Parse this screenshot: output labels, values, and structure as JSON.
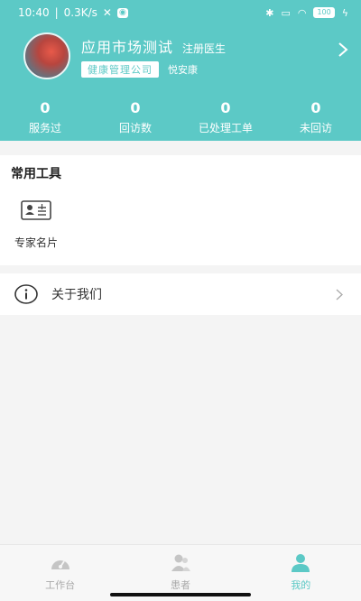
{
  "status": {
    "time": "10:40",
    "speed": "0.3K/s",
    "battery": "100"
  },
  "profile": {
    "name": "应用市场测试",
    "role": "注册医生",
    "org": "健康管理公司",
    "brand": "悦安康"
  },
  "stats": [
    {
      "value": "0",
      "label": "服务过"
    },
    {
      "value": "0",
      "label": "回访数"
    },
    {
      "value": "0",
      "label": "已处理工单"
    },
    {
      "value": "0",
      "label": "未回访"
    }
  ],
  "tools": {
    "title": "常用工具",
    "items": [
      {
        "label": "专家名片",
        "icon": "id-card-icon"
      }
    ]
  },
  "about": {
    "label": "关于我们"
  },
  "tabs": [
    {
      "label": "工作台",
      "icon": "dashboard-icon"
    },
    {
      "label": "患者",
      "icon": "patients-icon"
    },
    {
      "label": "我的",
      "icon": "person-icon",
      "active": true
    }
  ],
  "colors": {
    "accent": "#5cc9c6"
  }
}
